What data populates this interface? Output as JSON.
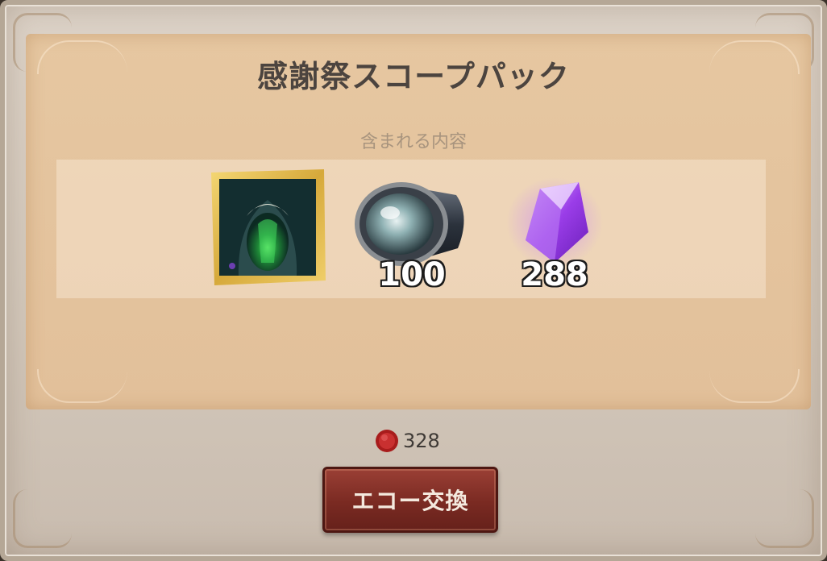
{
  "pack": {
    "title": "感謝祭スコープパック",
    "contents_label": "含まれる内容"
  },
  "items": [
    {
      "icon": "character-costume-card-icon",
      "count": ""
    },
    {
      "icon": "telescope-lens-icon",
      "count": "100"
    },
    {
      "icon": "purple-crystal-icon",
      "count": "288"
    }
  ],
  "price": {
    "currency_icon": "red-echo-coin-icon",
    "value": "328"
  },
  "exchange_button": {
    "label": "エコー交換"
  },
  "colors": {
    "panel": "#e2c09a",
    "button": "#7a2a22",
    "title_text": "#4c443f"
  }
}
